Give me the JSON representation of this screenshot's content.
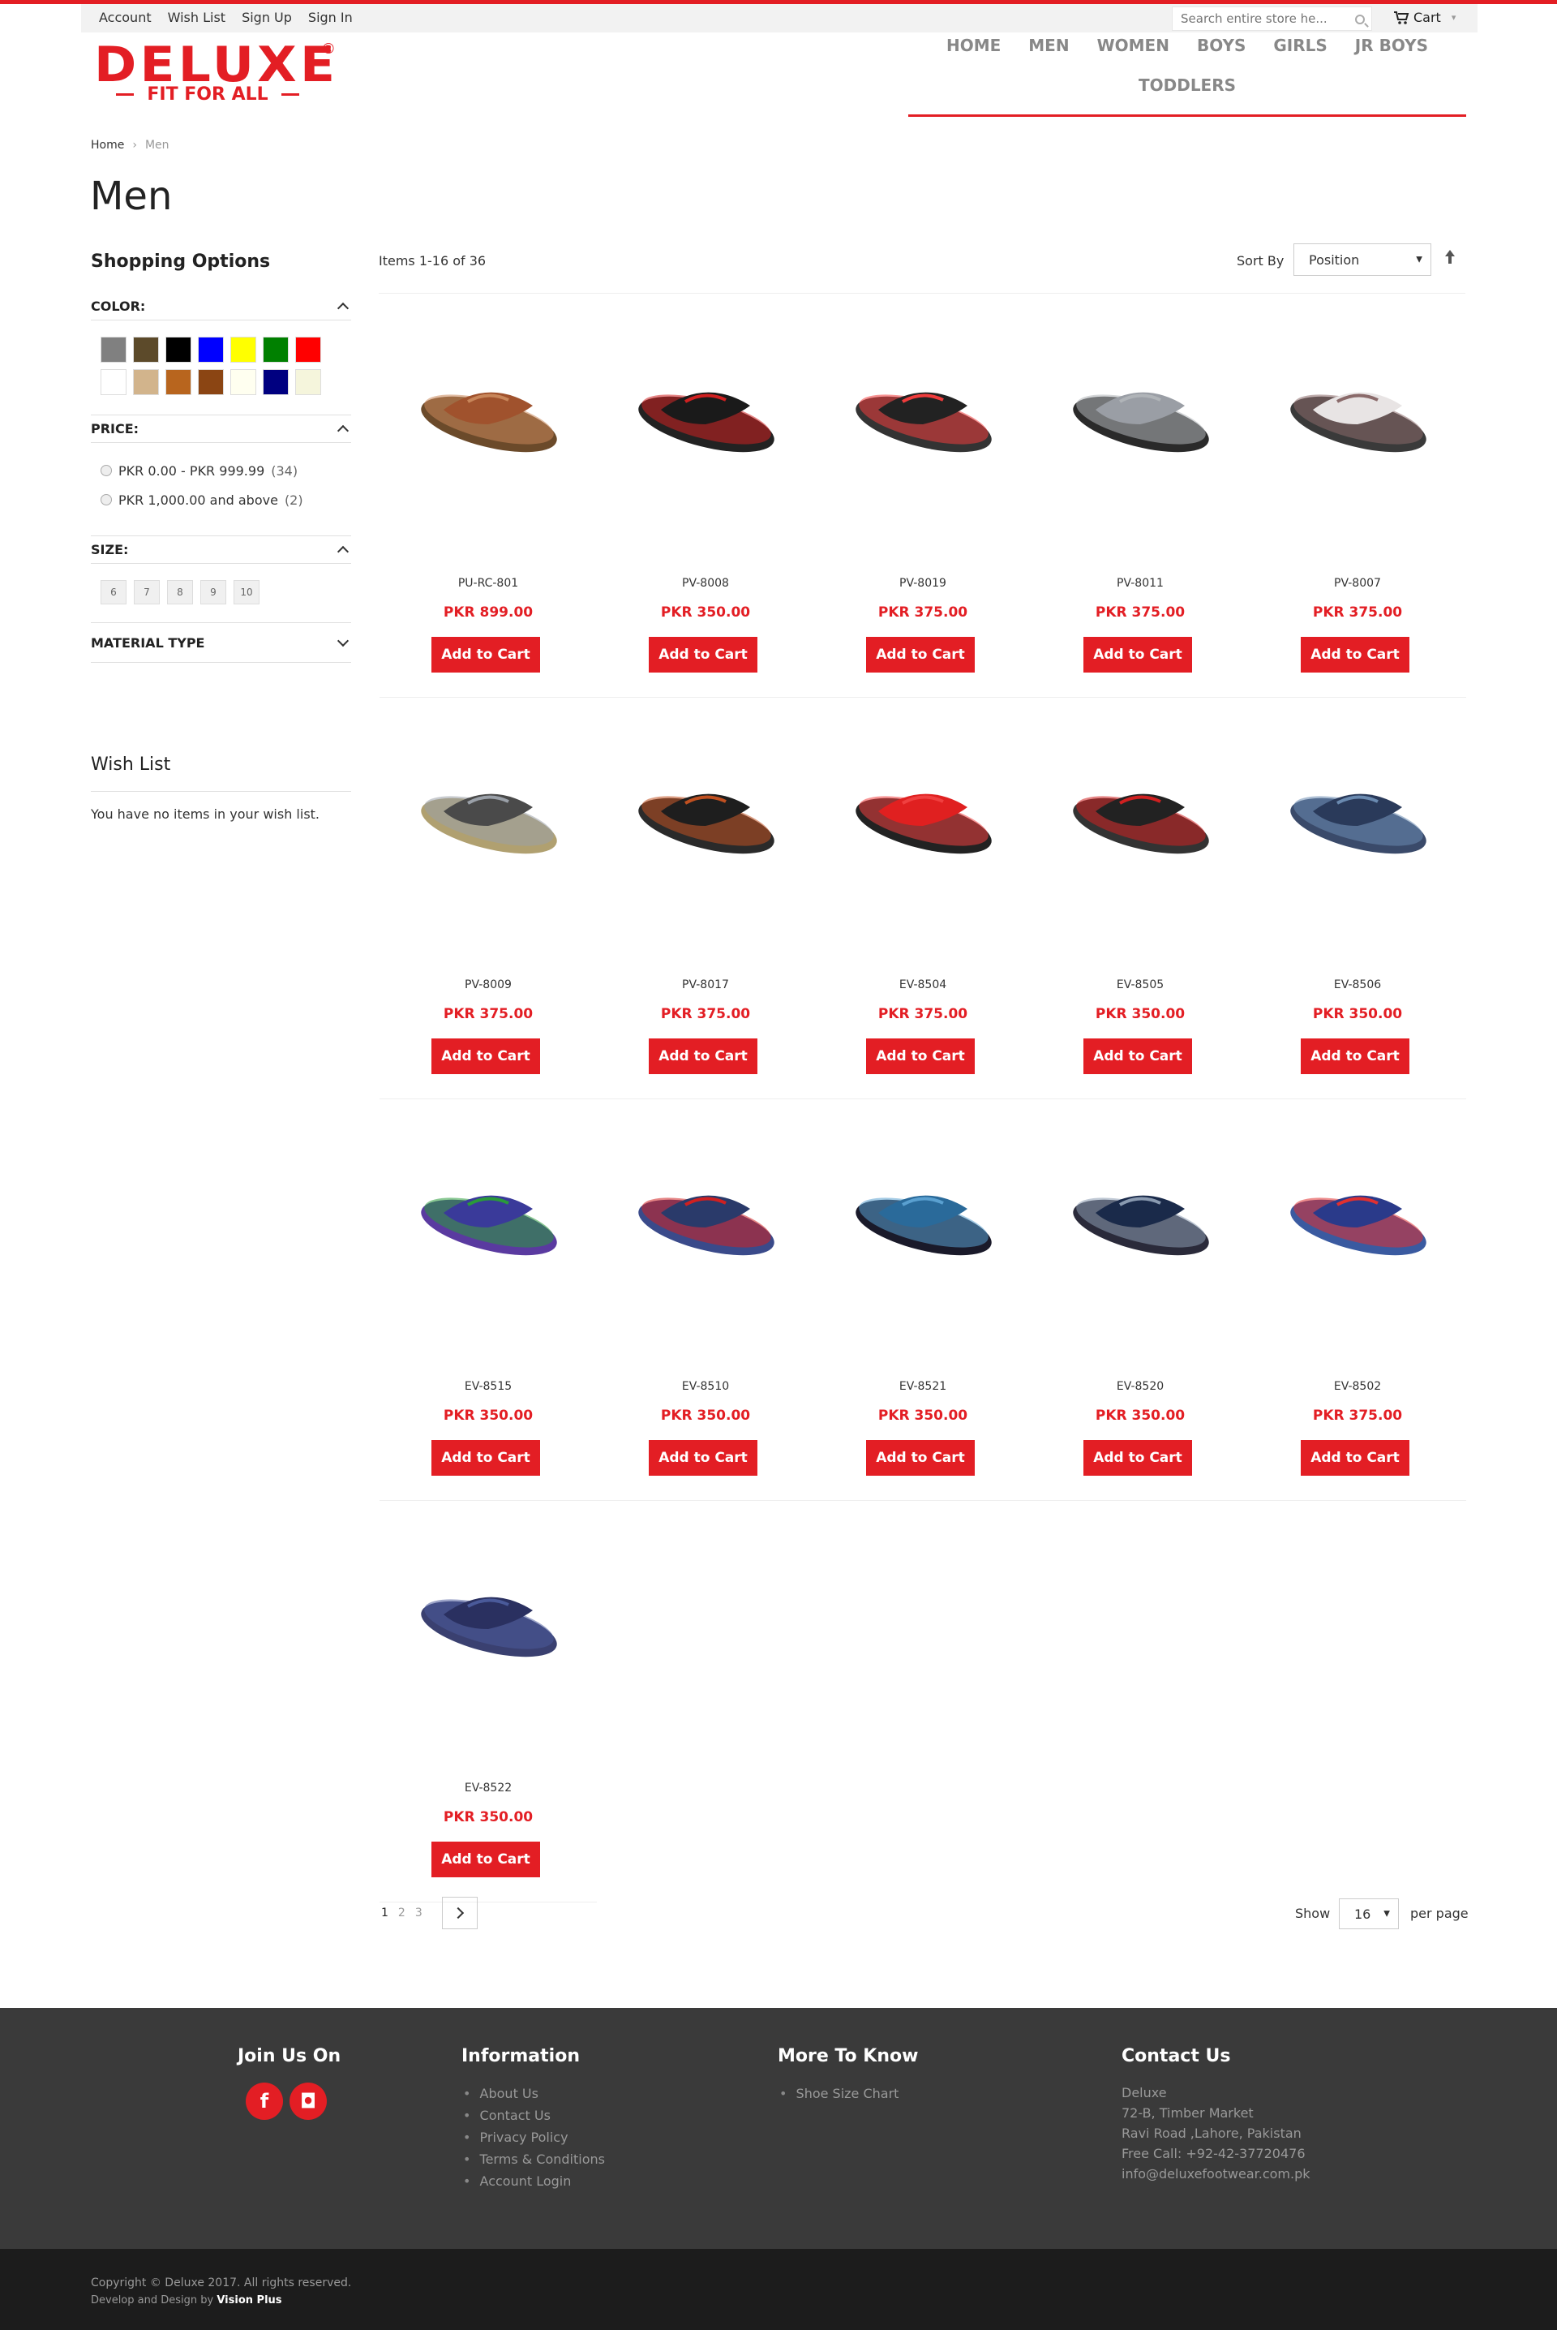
{
  "top_links": [
    "Account",
    "Wish List",
    "Sign Up",
    "Sign In"
  ],
  "search": {
    "placeholder": "Search entire store he..."
  },
  "cart_label": "Cart",
  "logo": {
    "word": "DELUXE",
    "tagline": "FIT FOR ALL",
    "reg": "®"
  },
  "nav": [
    "HOME",
    "MEN",
    "WOMEN",
    "BOYS",
    "GIRLS",
    "JR BOYS",
    "TODDLERS"
  ],
  "breadcrumb": {
    "home": "Home",
    "sep": "›",
    "current": "Men"
  },
  "page_title": "Men",
  "sidebar": {
    "title": "Shopping Options",
    "color_label": "COLOR:",
    "colors": [
      "#808080",
      "#5c4a2a",
      "#000000",
      "#0000ff",
      "#ffff00",
      "#008000",
      "#ff0000",
      "#ffffff",
      "#d2b48c",
      "#b8651e",
      "#8b4513",
      "#fffff0",
      "#000080",
      "#f5f5dc"
    ],
    "price_label": "PRICE:",
    "prices": [
      {
        "label": "PKR 0.00 - PKR 999.99",
        "count": "(34)"
      },
      {
        "label": "PKR 1,000.00 and above",
        "count": "(2)"
      }
    ],
    "size_label": "SIZE:",
    "sizes": [
      "6",
      "7",
      "8",
      "9",
      "10"
    ],
    "material_label": "MATERIAL TYPE"
  },
  "wishlist": {
    "title": "Wish List",
    "empty": "You have no items in your wish list."
  },
  "toolbar": {
    "amount": "Items 1-16 of 36",
    "sort_label": "Sort By",
    "sort_value": "Position",
    "show_label": "Show",
    "per_page_value": "16",
    "per_page_label": "per page"
  },
  "add_to_cart": "Add to Cart",
  "products": [
    {
      "sku": "PU-RC-801",
      "price": "PKR 899.00",
      "strap": "#a0522d",
      "sole": "#6b4a2a",
      "accent": "#c8865a"
    },
    {
      "sku": "PV-8008",
      "price": "PKR 350.00",
      "strap": "#1a1a1a",
      "sole": "#222222",
      "accent": "#d02020"
    },
    {
      "sku": "PV-8019",
      "price": "PKR 375.00",
      "strap": "#222222",
      "sole": "#333333",
      "accent": "#f03c3c"
    },
    {
      "sku": "PV-8011",
      "price": "PKR 375.00",
      "strap": "#9a9ea5",
      "sole": "#2a2a2a",
      "accent": "#b0b4b8"
    },
    {
      "sku": "PV-8007",
      "price": "PKR 375.00",
      "strap": "#e8e4e4",
      "sole": "#3a3a3a",
      "accent": "#8a6a6a"
    },
    {
      "sku": "PV-8009",
      "price": "PKR 375.00",
      "strap": "#4a4a4a",
      "sole": "#b0a070",
      "accent": "#9aa0a8"
    },
    {
      "sku": "PV-8017",
      "price": "PKR 375.00",
      "strap": "#1e1e1e",
      "sole": "#2a2a2a",
      "accent": "#c05020"
    },
    {
      "sku": "EV-8504",
      "price": "PKR 375.00",
      "strap": "#e02020",
      "sole": "#222222",
      "accent": "#f04040"
    },
    {
      "sku": "EV-8505",
      "price": "PKR 350.00",
      "strap": "#222222",
      "sole": "#333333",
      "accent": "#d02020"
    },
    {
      "sku": "EV-8506",
      "price": "PKR 350.00",
      "strap": "#2a3a5a",
      "sole": "#3a4a6a",
      "accent": "#6a8ab0"
    },
    {
      "sku": "EV-8515",
      "price": "PKR 350.00",
      "strap": "#3a3a9a",
      "sole": "#5a3aa0",
      "accent": "#2a9a3a"
    },
    {
      "sku": "EV-8510",
      "price": "PKR 350.00",
      "strap": "#2a3a6a",
      "sole": "#3a4a8a",
      "accent": "#d02020"
    },
    {
      "sku": "EV-8521",
      "price": "PKR 350.00",
      "strap": "#2a6a9a",
      "sole": "#1a1a2a",
      "accent": "#5aa0d0"
    },
    {
      "sku": "EV-8520",
      "price": "PKR 350.00",
      "strap": "#1a2a4a",
      "sole": "#2a2a3a",
      "accent": "#8a9ab0"
    },
    {
      "sku": "EV-8502",
      "price": "PKR 375.00",
      "strap": "#2a3a8a",
      "sole": "#3a5aa0",
      "accent": "#e03030"
    },
    {
      "sku": "EV-8522",
      "price": "PKR 350.00",
      "strap": "#2a3060",
      "sole": "#3a4070",
      "accent": "#4a5a9a"
    }
  ],
  "pager": {
    "pages": [
      "1",
      "2",
      "3"
    ],
    "current": "1"
  },
  "footer": {
    "join": "Join Us On",
    "social": [
      "f",
      "◘"
    ],
    "info_title": "Information",
    "info_links": [
      "About Us",
      "Contact Us",
      "Privacy Policy",
      "Terms & Conditions",
      "Account Login"
    ],
    "more_title": "More To Know",
    "more_links": [
      "Shoe Size Chart"
    ],
    "contact_title": "Contact Us",
    "contact_lines": [
      "Deluxe",
      "72-B, Timber Market",
      "Ravi Road ,Lahore, Pakistan",
      "Free Call: +92-42-37720476",
      "info@deluxefootwear.com.pk"
    ]
  },
  "copyright": "Copyright © Deluxe 2017. All rights reserved.",
  "credit_prefix": "Develop and Design by ",
  "credit_name": "Vision Plus",
  "colors": {
    "accent": "#e31e24",
    "footer_bg": "#3a3a3a",
    "bottom_bg": "#1c1c1c"
  }
}
